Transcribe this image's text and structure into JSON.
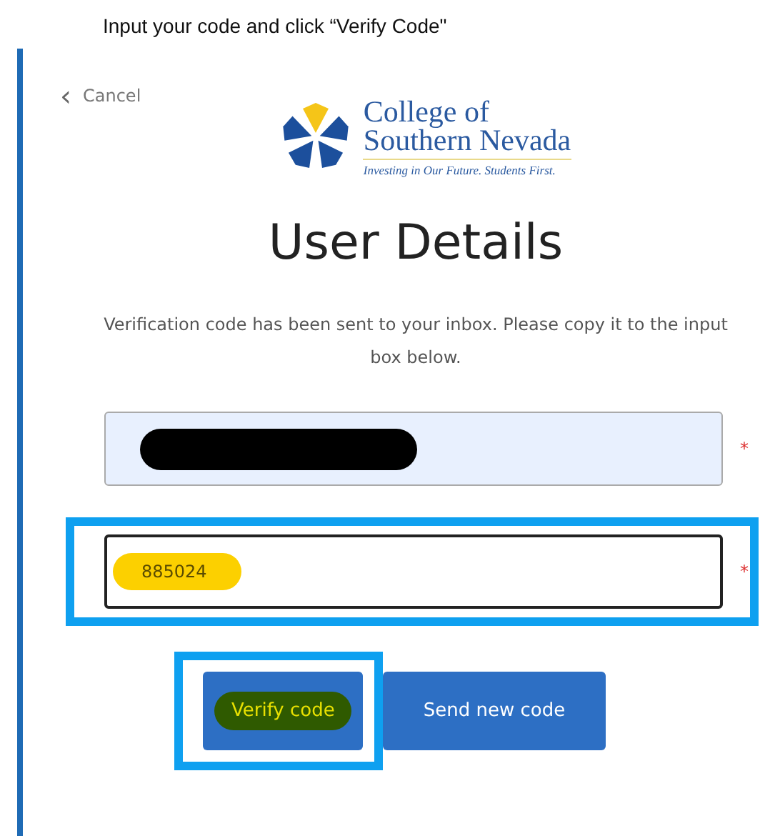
{
  "caption": "Input your code and click “Verify Code\"",
  "cancel": {
    "icon": "‹",
    "label": "Cancel"
  },
  "logo": {
    "lines": [
      "College of",
      "Southern Nevada"
    ],
    "tagline": "Investing in Our Future. Students First."
  },
  "title": "User Details",
  "message": "Verification code has been sent to your inbox. Please copy it to the input box below.",
  "fields": [
    {
      "kind": "redacted",
      "required_mark": "*",
      "highlighted": false
    },
    {
      "kind": "code",
      "value": "885024",
      "required_mark": "*",
      "highlighted": true
    }
  ],
  "buttons": [
    {
      "label": "Verify code",
      "highlighted": true
    },
    {
      "label": "Send new code",
      "highlighted": false
    }
  ]
}
